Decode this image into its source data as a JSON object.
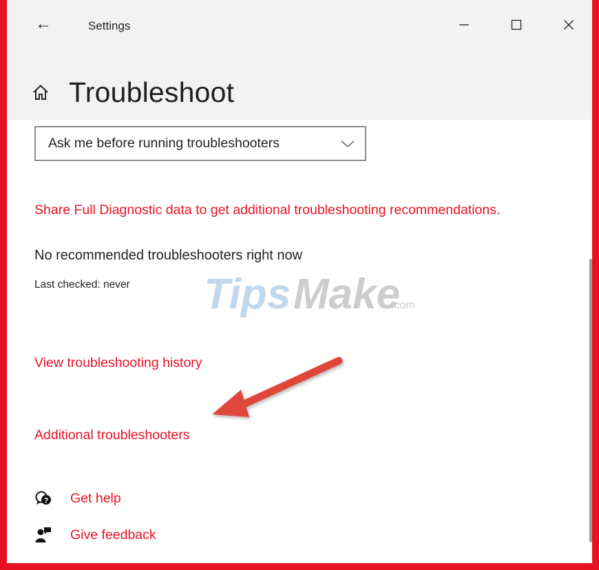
{
  "window": {
    "back_glyph": "←",
    "title": "Settings",
    "controls": [
      "minimize-icon",
      "maximize-icon",
      "close-icon"
    ]
  },
  "page": {
    "home_icon": "home-icon",
    "title": "Troubleshoot"
  },
  "dropdown": {
    "selected": "Ask me before running troubleshooters",
    "icon": "chevron-down-icon"
  },
  "content": {
    "diagnostic_link": "Share Full Diagnostic data to get additional troubleshooting recommendations.",
    "status": "No recommended troubleshooters right now",
    "last_checked": "Last checked: never",
    "history_link": "View troubleshooting history",
    "additional_link": "Additional troubleshooters"
  },
  "help": {
    "get_help": {
      "label": "Get help",
      "icon": "get-help-icon"
    },
    "give_feedback": {
      "label": "Give feedback",
      "icon": "give-feedback-icon"
    }
  },
  "watermark": {
    "brand_a": "Tips",
    "brand_b": "Make",
    "suffix": ".com"
  },
  "colors": {
    "accent": "#e81123",
    "header_bg": "#f2f2f2",
    "annotation_arrow": "#e0463a"
  }
}
